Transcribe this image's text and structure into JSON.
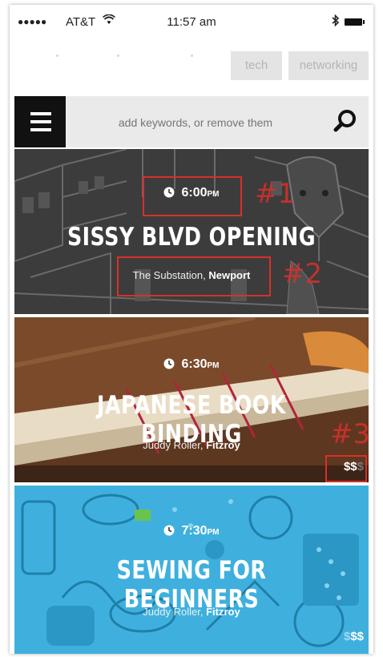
{
  "status_bar": {
    "signal": "●●●●●",
    "carrier": "AT&T",
    "wifi_icon": "wifi-icon",
    "time": "11:57 am",
    "bluetooth_icon": "bluetooth-icon",
    "battery_icon": "battery-icon"
  },
  "tags": [
    "tech",
    "networking"
  ],
  "search": {
    "placeholder": "add keywords, or remove them",
    "menu_icon": "hamburger-menu-icon",
    "search_icon": "search-icon"
  },
  "events": [
    {
      "time": "6:00",
      "ampm": "PM",
      "title": "SISSY BLVD OPENING",
      "venue": "The Substation,",
      "suburb": "Newport",
      "price": "",
      "price_dim": ""
    },
    {
      "time": "6:30",
      "ampm": "PM",
      "title": "JAPANESE BOOK BINDING",
      "venue": "Juddy Roller,",
      "suburb": "Fitzroy",
      "price": "$$",
      "price_dim": "$"
    },
    {
      "time": "7:30",
      "ampm": "PM",
      "title": "SEWING FOR BEGINNERS",
      "venue": "Juddy Roller,",
      "suburb": "Fitzroy",
      "price": "$$",
      "price_dim": "$"
    }
  ],
  "annotations": [
    "#1",
    "#2",
    "#3"
  ],
  "colors": {
    "annotation": "#d8302a",
    "card1": "#3a3a3a",
    "card2": "#6b3d22",
    "card3": "#3fb0de"
  }
}
